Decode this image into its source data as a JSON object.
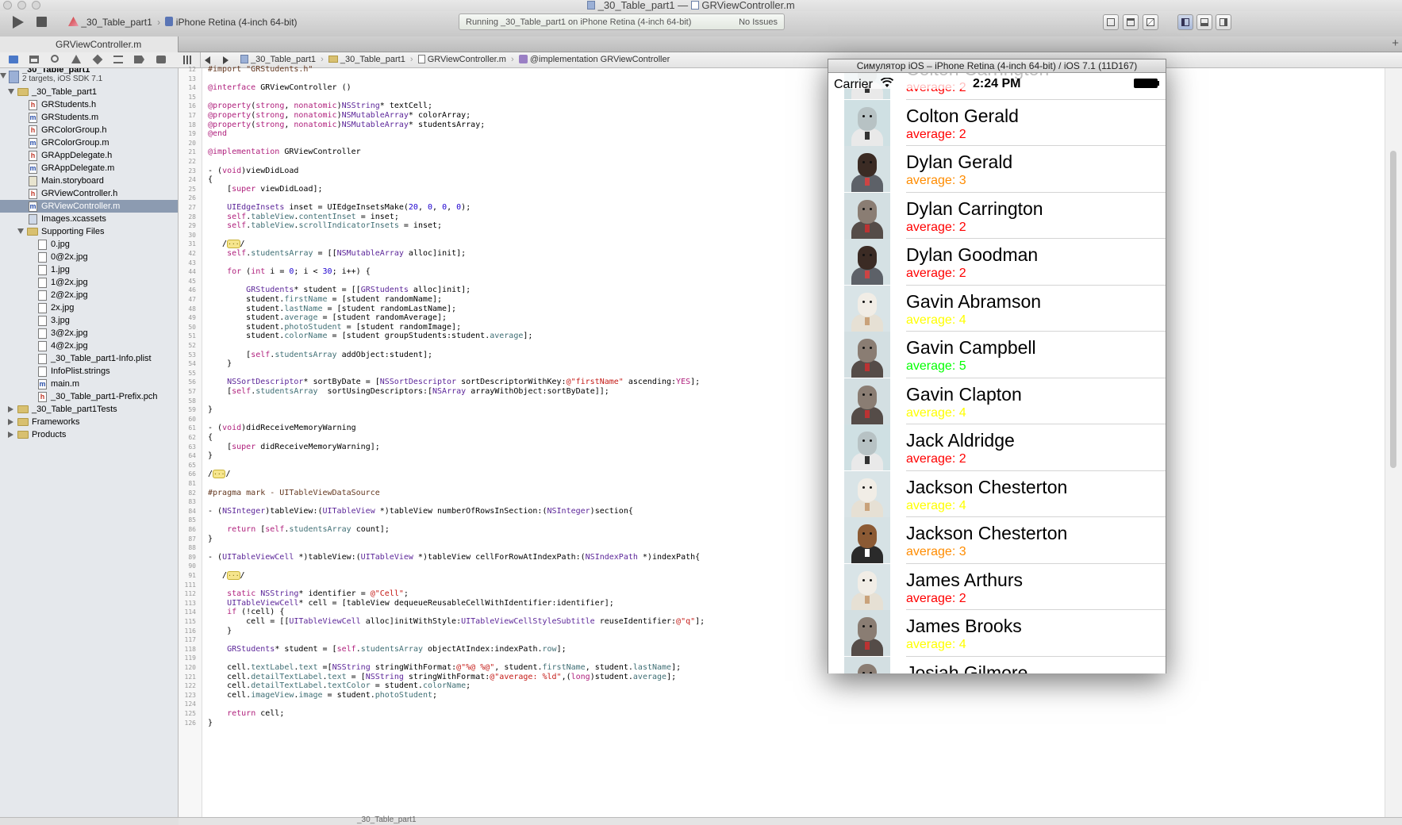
{
  "window": {
    "title": "_30_Table_part1",
    "title_separator": "—",
    "title_file": "GRViewController.m"
  },
  "toolbar": {
    "scheme": "_30_Table_part1",
    "destination": "iPhone Retina (4-inch 64-bit)",
    "activity": "Running _30_Table_part1 on iPhone Retina (4-inch 64-bit)",
    "issues": "No Issues",
    "run_icon": "play-icon",
    "stop_icon": "stop-icon"
  },
  "tab": {
    "label": "GRViewController.m",
    "add": "+"
  },
  "jumpbar": {
    "crumbs": [
      "_30_Table_part1",
      "_30_Table_part1",
      "GRViewController.m",
      "@implementation GRViewController"
    ],
    "sep": "›"
  },
  "project": {
    "name": "_30_Table_part1",
    "subtitle": "2 targets, iOS SDK 7.1",
    "items": [
      {
        "label": "_30_Table_part1",
        "kind": "folder",
        "depth": 1,
        "open": true
      },
      {
        "label": "GRStudents.h",
        "kind": "h",
        "depth": 2
      },
      {
        "label": "GRStudents.m",
        "kind": "m",
        "depth": 2
      },
      {
        "label": "GRColorGroup.h",
        "kind": "h",
        "depth": 2
      },
      {
        "label": "GRColorGroup.m",
        "kind": "m",
        "depth": 2
      },
      {
        "label": "GRAppDelegate.h",
        "kind": "h",
        "depth": 2
      },
      {
        "label": "GRAppDelegate.m",
        "kind": "m",
        "depth": 2
      },
      {
        "label": "Main.storyboard",
        "kind": "sb",
        "depth": 2
      },
      {
        "label": "GRViewController.h",
        "kind": "h",
        "depth": 2
      },
      {
        "label": "GRViewController.m",
        "kind": "m",
        "depth": 2,
        "selected": true
      },
      {
        "label": "Images.xcassets",
        "kind": "assets",
        "depth": 2
      },
      {
        "label": "Supporting Files",
        "kind": "folder",
        "depth": 2,
        "open": true
      },
      {
        "label": "0.jpg",
        "kind": "img",
        "depth": 3
      },
      {
        "label": "0@2x.jpg",
        "kind": "img",
        "depth": 3
      },
      {
        "label": "1.jpg",
        "kind": "img",
        "depth": 3
      },
      {
        "label": "1@2x.jpg",
        "kind": "img",
        "depth": 3
      },
      {
        "label": "2@2x.jpg",
        "kind": "img",
        "depth": 3
      },
      {
        "label": "2x.jpg",
        "kind": "img",
        "depth": 3
      },
      {
        "label": "3.jpg",
        "kind": "img",
        "depth": 3
      },
      {
        "label": "3@2x.jpg",
        "kind": "img",
        "depth": 3
      },
      {
        "label": "4@2x.jpg",
        "kind": "img",
        "depth": 3
      },
      {
        "label": "_30_Table_part1-Info.plist",
        "kind": "plist",
        "depth": 3
      },
      {
        "label": "InfoPlist.strings",
        "kind": "strings",
        "depth": 3
      },
      {
        "label": "main.m",
        "kind": "m",
        "depth": 3
      },
      {
        "label": "_30_Table_part1-Prefix.pch",
        "kind": "pch",
        "depth": 3
      },
      {
        "label": "_30_Table_part1Tests",
        "kind": "folder",
        "depth": 1,
        "open": false
      },
      {
        "label": "Frameworks",
        "kind": "folder",
        "depth": 1,
        "open": false
      },
      {
        "label": "Products",
        "kind": "folder",
        "depth": 1,
        "open": false
      }
    ]
  },
  "code": {
    "lines": [
      {
        "n": "12",
        "t": "#import \"GRStudents.h\""
      },
      {
        "n": "13",
        "t": ""
      },
      {
        "n": "14",
        "t": "@interface GRViewController ()"
      },
      {
        "n": "15",
        "t": ""
      },
      {
        "n": "16",
        "t": "@property(strong, nonatomic)NSString* textCell;"
      },
      {
        "n": "17",
        "t": "@property(strong, nonatomic)NSMutableArray* colorArray;"
      },
      {
        "n": "18",
        "t": "@property(strong, nonatomic)NSMutableArray* studentsArray;"
      },
      {
        "n": "19",
        "t": "@end"
      },
      {
        "n": "20",
        "t": ""
      },
      {
        "n": "21",
        "t": "@implementation GRViewController"
      },
      {
        "n": "22",
        "t": ""
      },
      {
        "n": "23",
        "t": "- (void)viewDidLoad"
      },
      {
        "n": "24",
        "t": "{"
      },
      {
        "n": "25",
        "t": "    [super viewDidLoad];"
      },
      {
        "n": "26",
        "t": ""
      },
      {
        "n": "27",
        "t": "    UIEdgeInsets inset = UIEdgeInsetsMake(20, 0, 0, 0);"
      },
      {
        "n": "28",
        "t": "    self.tableView.contentInset = inset;"
      },
      {
        "n": "29",
        "t": "    self.tableView.scrollIndicatorInsets = inset;"
      },
      {
        "n": "30",
        "t": ""
      },
      {
        "n": "31",
        "t": "   /···/"
      },
      {
        "n": "42",
        "t": "    self.studentsArray = [[NSMutableArray alloc]init];"
      },
      {
        "n": "43",
        "t": ""
      },
      {
        "n": "44",
        "t": "    for (int i = 0; i < 30; i++) {"
      },
      {
        "n": "45",
        "t": ""
      },
      {
        "n": "46",
        "t": "        GRStudents* student = [[GRStudents alloc]init];"
      },
      {
        "n": "47",
        "t": "        student.firstName = [student randomName];"
      },
      {
        "n": "48",
        "t": "        student.lastName = [student randomLastName];"
      },
      {
        "n": "49",
        "t": "        student.average = [student randomAverage];"
      },
      {
        "n": "50",
        "t": "        student.photoStudent = [student randomImage];"
      },
      {
        "n": "51",
        "t": "        student.colorName = [student groupStudents:student.average];"
      },
      {
        "n": "52",
        "t": ""
      },
      {
        "n": "53",
        "t": "        [self.studentsArray addObject:student];"
      },
      {
        "n": "54",
        "t": "    }"
      },
      {
        "n": "55",
        "t": ""
      },
      {
        "n": "56",
        "t": "    NSSortDescriptor* sortByDate = [NSSortDescriptor sortDescriptorWithKey:@\"firstName\" ascending:YES];"
      },
      {
        "n": "57",
        "t": "    [self.studentsArray  sortUsingDescriptors:[NSArray arrayWithObject:sortByDate]];"
      },
      {
        "n": "58",
        "t": ""
      },
      {
        "n": "59",
        "t": "}"
      },
      {
        "n": "60",
        "t": ""
      },
      {
        "n": "61",
        "t": "- (void)didReceiveMemoryWarning"
      },
      {
        "n": "62",
        "t": "{"
      },
      {
        "n": "63",
        "t": "    [super didReceiveMemoryWarning];"
      },
      {
        "n": "64",
        "t": "}"
      },
      {
        "n": "65",
        "t": ""
      },
      {
        "n": "66",
        "t": "/···/"
      },
      {
        "n": "81",
        "t": ""
      },
      {
        "n": "82",
        "t": "#pragma mark - UITableViewDataSource"
      },
      {
        "n": "83",
        "t": ""
      },
      {
        "n": "84",
        "t": "- (NSInteger)tableView:(UITableView *)tableView numberOfRowsInSection:(NSInteger)section{"
      },
      {
        "n": "85",
        "t": ""
      },
      {
        "n": "86",
        "t": "    return [self.studentsArray count];"
      },
      {
        "n": "87",
        "t": "}"
      },
      {
        "n": "88",
        "t": ""
      },
      {
        "n": "89",
        "t": "- (UITableViewCell *)tableView:(UITableView *)tableView cellForRowAtIndexPath:(NSIndexPath *)indexPath{"
      },
      {
        "n": "90",
        "t": ""
      },
      {
        "n": "91",
        "t": "   /···/"
      },
      {
        "n": "111",
        "t": ""
      },
      {
        "n": "112",
        "t": "    static NSString* identifier = @\"Cell\";"
      },
      {
        "n": "113",
        "t": "    UITableViewCell* cell = [tableView dequeueReusableCellWithIdentifier:identifier];"
      },
      {
        "n": "114",
        "t": "    if (!cell) {"
      },
      {
        "n": "115",
        "t": "        cell = [[UITableViewCell alloc]initWithStyle:UITableViewCellStyleSubtitle reuseIdentifier:@\"q\"];"
      },
      {
        "n": "116",
        "t": "    }"
      },
      {
        "n": "117",
        "t": ""
      },
      {
        "n": "118",
        "t": "    GRStudents* student = [self.studentsArray objectAtIndex:indexPath.row];"
      },
      {
        "n": "119",
        "t": ""
      },
      {
        "n": "120",
        "t": "    cell.textLabel.text =[NSString stringWithFormat:@\"%@ %@\", student.firstName, student.lastName];"
      },
      {
        "n": "121",
        "t": "    cell.detailTextLabel.text = [NSString stringWithFormat:@\"average: %ld\",(long)student.average];"
      },
      {
        "n": "122",
        "t": "    cell.detailTextLabel.textColor = student.colorName;"
      },
      {
        "n": "123",
        "t": "    cell.imageView.image = student.photoStudent;"
      },
      {
        "n": "124",
        "t": ""
      },
      {
        "n": "125",
        "t": "    return cell;"
      },
      {
        "n": "126",
        "t": "}"
      }
    ]
  },
  "bottombar": {
    "label": "_30_Table_part1"
  },
  "simulator": {
    "title": "Симулятор iOS – iPhone Retina (4-inch 64-bit) / iOS 7.1 (11D167)",
    "carrier": "Carrier",
    "time": "2:24 PM",
    "rows": [
      {
        "name": "Colton Carrington",
        "avg": "average: 2",
        "color": "#ff0000",
        "animal": "ostrich"
      },
      {
        "name": "Colton Gerald",
        "avg": "average: 2",
        "color": "#ff0000",
        "animal": "ostrich"
      },
      {
        "name": "Dylan Gerald",
        "avg": "average: 3",
        "color": "#ff8c00",
        "animal": "bear"
      },
      {
        "name": "Dylan Carrington",
        "avg": "average: 2",
        "color": "#ff0000",
        "animal": "rhino"
      },
      {
        "name": "Dylan Goodman",
        "avg": "average: 2",
        "color": "#ff0000",
        "animal": "bear"
      },
      {
        "name": "Gavin Abramson",
        "avg": "average: 4",
        "color": "#ffff00",
        "animal": "monkey"
      },
      {
        "name": "Gavin Campbell",
        "avg": "average: 5",
        "color": "#00ff00",
        "animal": "rhino"
      },
      {
        "name": "Gavin Clapton",
        "avg": "average: 4",
        "color": "#ffff00",
        "animal": "rhino"
      },
      {
        "name": "Jack Aldridge",
        "avg": "average: 2",
        "color": "#ff0000",
        "animal": "ostrich"
      },
      {
        "name": "Jackson Chesterton",
        "avg": "average: 4",
        "color": "#ffff00",
        "animal": "monkey"
      },
      {
        "name": "Jackson Chesterton",
        "avg": "average: 3",
        "color": "#ff8c00",
        "animal": "wolf"
      },
      {
        "name": "James Arthurs",
        "avg": "average: 2",
        "color": "#ff0000",
        "animal": "monkey"
      },
      {
        "name": "James Brooks",
        "avg": "average: 4",
        "color": "#ffff00",
        "animal": "rhino"
      },
      {
        "name": "Josiah Gilmore",
        "avg": "",
        "color": "#ff0000",
        "animal": "rhino"
      }
    ]
  }
}
